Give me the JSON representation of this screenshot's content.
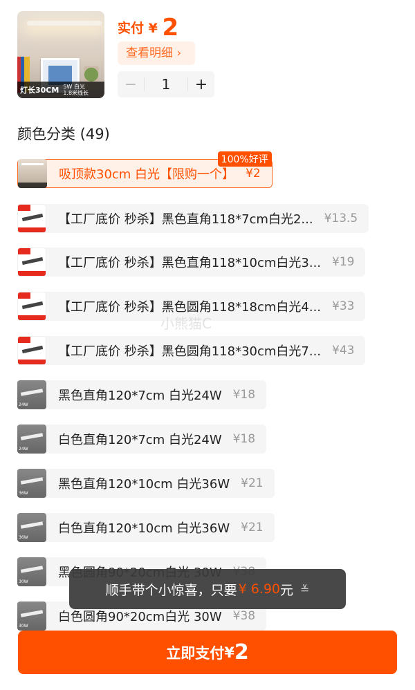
{
  "header": {
    "thumb_caption": "灯长30CM",
    "thumb_specs": [
      "5W 白光",
      "1.8米线长"
    ],
    "pay_label": "实付",
    "currency": "¥",
    "pay_amount": "2",
    "detail_button": "查看明细",
    "detail_chevron": "›",
    "quantity": "1",
    "minus_label": "−",
    "plus_label": "+"
  },
  "section": {
    "title": "颜色分类 (49)"
  },
  "options": [
    {
      "text": "吸顶款30cm 白光【限购一个】",
      "price": "¥2",
      "badge": "100%好评",
      "selected": true
    },
    {
      "text": "【工厂底价 秒杀】黑色直角118*7cm白光2...",
      "price": "¥13.5"
    },
    {
      "text": "【工厂底价 秒杀】黑色直角118*10cm白光3...",
      "price": "¥19"
    },
    {
      "text": "【工厂底价 秒杀】黑色圆角118*18cm白光4...",
      "price": "¥33"
    },
    {
      "text": "【工厂底价 秒杀】黑色圆角118*30cm白光7...",
      "price": "¥43"
    },
    {
      "text": "黑色直角120*7cm 白光24W",
      "price": "¥18",
      "img_tag": "24W"
    },
    {
      "text": "白色直角120*7cm 白光24W",
      "price": "¥18",
      "img_tag": "24W"
    },
    {
      "text": "黑色直角120*10cm 白光36W",
      "price": "¥21",
      "img_tag": "36W"
    },
    {
      "text": "白色直角120*10cm 白光36W",
      "price": "¥21",
      "img_tag": "36W"
    },
    {
      "text": "黑色圆角90*20cm白光 30W",
      "price": "¥38",
      "img_tag": "30W"
    },
    {
      "text": "白色圆角90*20cm白光 30W",
      "price": "¥38",
      "img_tag": "30W"
    }
  ],
  "watermark": "小熊猫C",
  "toast": {
    "text": "顺手带个小惊喜，只要",
    "price": "¥ 6.90",
    "unit": "元",
    "chevron": "≚"
  },
  "pay_button": {
    "label": "立即支付",
    "currency": "¥",
    "amount": "2"
  },
  "colors": {
    "accent": "#ff5000",
    "selected_bg": "#fff1e8",
    "option_bg": "#f5f5f5",
    "toast_bg": "#3a3a3a"
  }
}
